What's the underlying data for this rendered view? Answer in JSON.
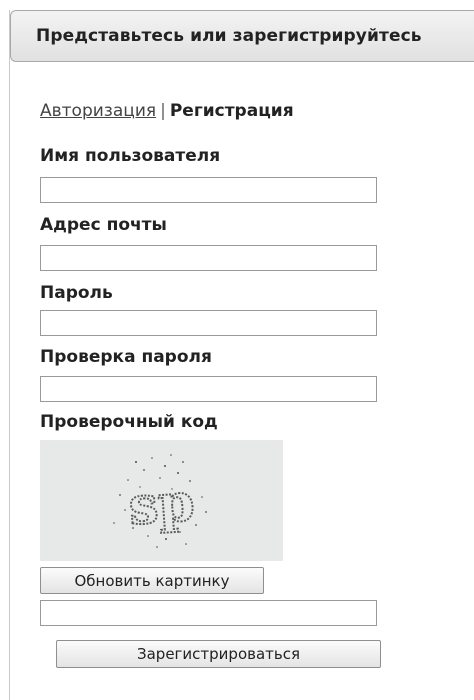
{
  "header": {
    "title": "Представьтесь или зарегистрируйтесь"
  },
  "tabs": {
    "login_label": "Авторизация",
    "separator": "|",
    "register_label": "Регистрация"
  },
  "form": {
    "username": {
      "label": "Имя пользователя",
      "value": ""
    },
    "email": {
      "label": "Адрес почты",
      "value": ""
    },
    "password": {
      "label": "Пароль",
      "value": ""
    },
    "password_confirm": {
      "label": "Проверка пароля",
      "value": ""
    },
    "captcha": {
      "label": "Проверочный код",
      "image_text": "sp",
      "refresh_label": "Обновить картинку",
      "value": ""
    },
    "submit_label": "Зарегистрироваться"
  }
}
